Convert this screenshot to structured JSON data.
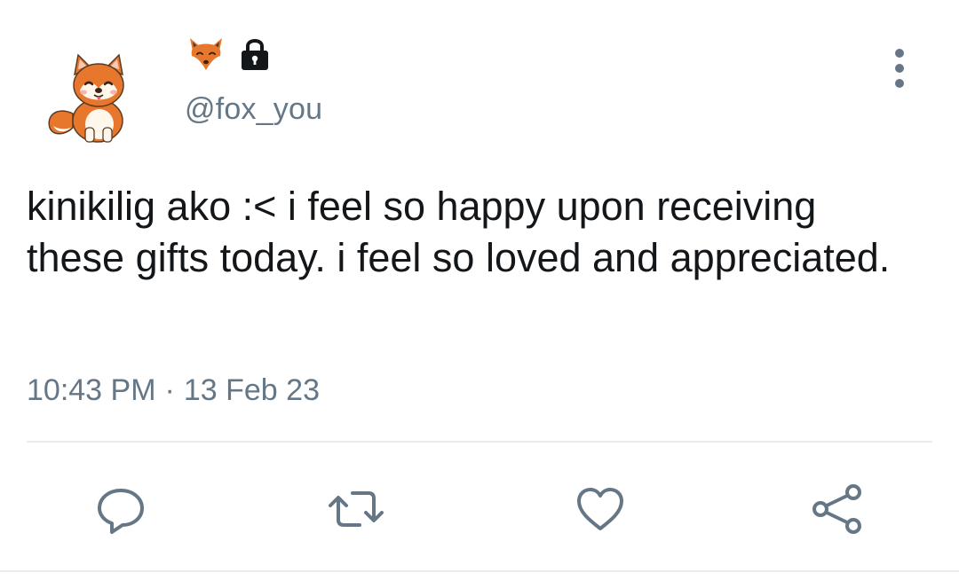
{
  "tweet": {
    "handle": "@fox_you",
    "name_icons": [
      "fox-face-icon",
      "lock-icon"
    ],
    "text": "kinikilig ako :< i feel so happy upon receiving these gifts today. i feel so loved and appreciated.",
    "time": "10:43 PM",
    "separator": "·",
    "date": "13 Feb 23"
  },
  "actions": [
    {
      "name": "reply",
      "icon": "reply-icon"
    },
    {
      "name": "retweet",
      "icon": "retweet-icon"
    },
    {
      "name": "like",
      "icon": "heart-icon"
    },
    {
      "name": "share",
      "icon": "share-icon"
    }
  ],
  "colors": {
    "text": "#14171a",
    "secondary": "#657786",
    "divider": "#e6ecf0",
    "fox_orange": "#e8772e"
  }
}
